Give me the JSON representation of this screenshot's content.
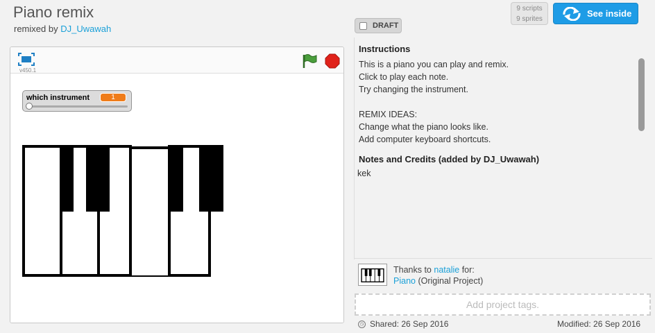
{
  "project": {
    "title": "Piano remix",
    "remixed_by_prefix": "remixed by",
    "author": "DJ_Uwawah"
  },
  "draft_label": "DRAFT",
  "counts": {
    "scripts": "9 scripts",
    "sprites": "9 sprites"
  },
  "see_inside_label": "See inside",
  "player": {
    "version": "v450.1",
    "variable_monitor": {
      "label": "which instrument",
      "value": "1",
      "slider_fraction": 0
    }
  },
  "instructions": {
    "heading": "Instructions",
    "text": "This is a piano you can play and remix.\nClick to play each note.\nTry changing the instrument.\n\nREMIX IDEAS:\nChange what the piano looks like.\nAdd computer keyboard shortcuts."
  },
  "notes": {
    "heading": "Notes and Credits (added by DJ_Uwawah)",
    "text": "kek"
  },
  "credit": {
    "thanks_prefix": "Thanks to",
    "user": "natalie",
    "for_suffix": "for:",
    "original_title": "Piano",
    "original_suffix": "(Original Project)"
  },
  "tags_placeholder": "Add project tags.",
  "footer": {
    "shared": "Shared: 26 Sep 2016",
    "modified": "Modified: 26 Sep 2016"
  },
  "colors": {
    "accent": "#1e9ce6",
    "link": "#1aa0d8",
    "monitor_value": "#ef7c1a",
    "flag": "#4a9e3c",
    "stop": "#e0221a"
  },
  "icons": [
    "fullscreen-icon",
    "green-flag-icon",
    "stop-icon",
    "remix-arrows-icon",
    "share-icon"
  ]
}
